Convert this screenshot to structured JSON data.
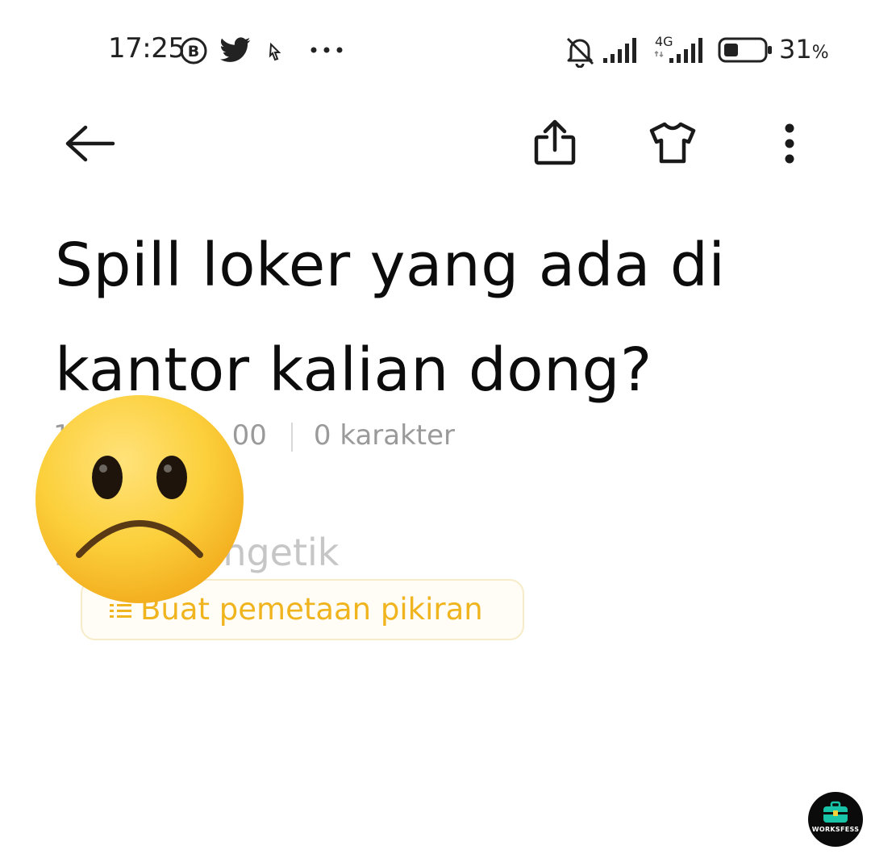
{
  "status_bar": {
    "time": "17:25",
    "network_type": "4G",
    "battery_percent": "31",
    "battery_unit": "%",
    "icons": [
      "bereal-b-icon",
      "twitter-icon",
      "cursor-icon",
      "more-dots-icon",
      "bell-off-icon",
      "signal-icon",
      "signal-4g-icon",
      "battery-icon"
    ]
  },
  "toolbar": {
    "icons": [
      "back-arrow-icon",
      "share-icon",
      "theme-shirt-icon",
      "more-vertical-icon"
    ]
  },
  "note": {
    "title_line1": "Spill loker yang ada di",
    "title_line2": "kantor kalian dong?",
    "date_fragment_start": "1",
    "date_fragment_end": "00",
    "char_count": "0 karakter",
    "placeholder": "Mulai mengetik",
    "mindmap_label": "Buat pemetaan pikiran"
  },
  "overlay": {
    "emoji": "frowning-face"
  },
  "watermark": {
    "text": "WORKSFESS"
  },
  "colors": {
    "accent": "#f0b41e",
    "text": "#0c0c0c",
    "muted": "#9a9a9a"
  }
}
